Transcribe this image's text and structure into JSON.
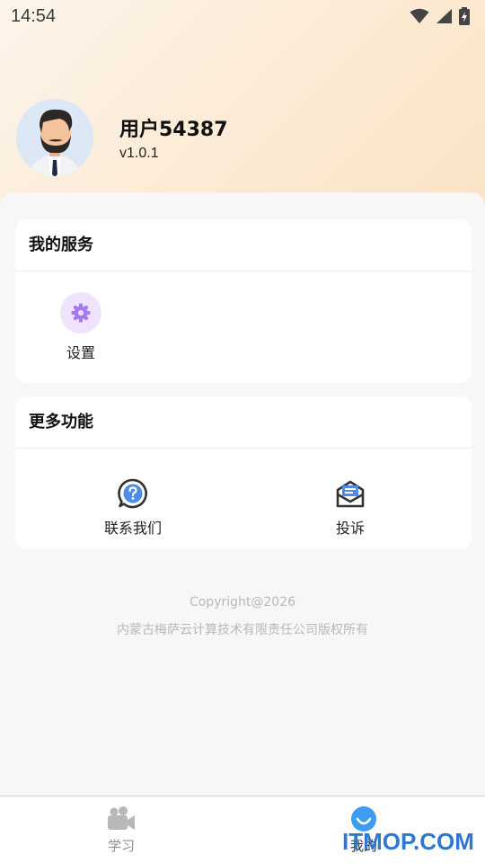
{
  "status_bar": {
    "time": "14:54",
    "icons": [
      "wifi-icon",
      "signal-icon",
      "battery-charging-icon"
    ]
  },
  "profile": {
    "username": "用户54387",
    "version": "v1.0.1",
    "avatar_icon": "man-avatar-icon"
  },
  "services": {
    "title": "我的服务",
    "items": [
      {
        "label": "设置",
        "icon": "gear-icon",
        "icon_color": "#a779f0"
      }
    ]
  },
  "more": {
    "title": "更多功能",
    "items": [
      {
        "label": "联系我们",
        "icon": "question-bubble-icon"
      },
      {
        "label": "投诉",
        "icon": "envelope-icon",
        "icon_color": "#4f8be8"
      }
    ]
  },
  "footer": {
    "copyright": "Copyright@2026",
    "company": "内蒙古梅萨云计算技术有限责任公司版权所有"
  },
  "tabbar": {
    "tabs": [
      {
        "label": "学习",
        "icon": "video-camera-icon",
        "active": false
      },
      {
        "label": "我的",
        "icon": "smile-face-icon",
        "active": true
      }
    ],
    "active_color": "#3d9cf0",
    "inactive_color": "#9a9a9a"
  },
  "watermark": {
    "text": "ITMOP.COM"
  },
  "colors": {
    "hero_gradient_start": "#fdf4ea",
    "hero_gradient_end": "#fae3c4",
    "accent": "#3d9cf0"
  }
}
